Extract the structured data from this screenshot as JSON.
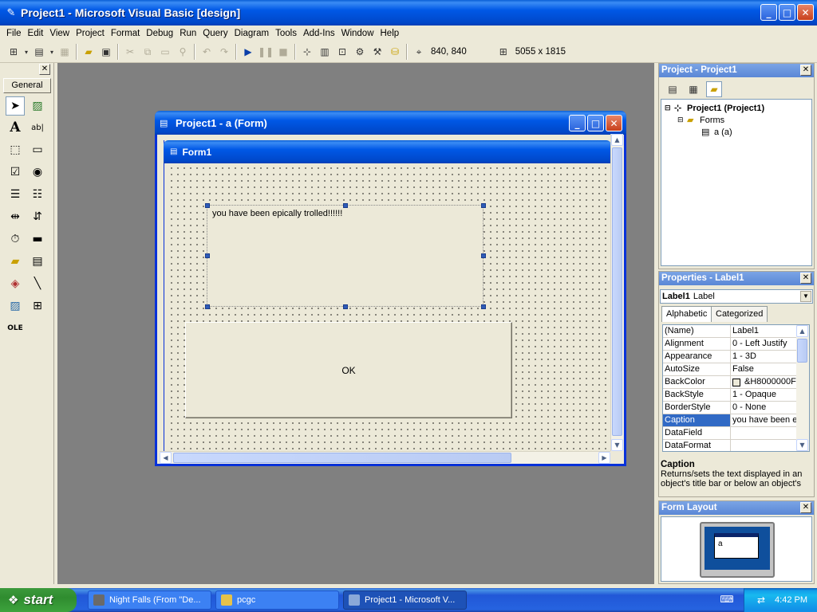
{
  "title_bar": {
    "title": "Project1 - Microsoft Visual Basic [design]"
  },
  "menu": [
    "File",
    "Edit",
    "View",
    "Project",
    "Format",
    "Debug",
    "Run",
    "Query",
    "Diagram",
    "Tools",
    "Add-Ins",
    "Window",
    "Help"
  ],
  "toolbar": {
    "position": "840, 840",
    "size": "5055 x 1815"
  },
  "toolbox": {
    "tab_label": "General"
  },
  "designer": {
    "window_title": "Project1 - a (Form)",
    "form_caption": "Form1",
    "label_caption": "you have been epically trolled!!!!!!",
    "button_caption": "OK"
  },
  "project_explorer": {
    "title": "Project - Project1",
    "root": "Project1 (Project1)",
    "folder": "Forms",
    "item": "a (a)"
  },
  "properties": {
    "title": "Properties - Label1",
    "object_name": "Label1",
    "object_type": "Label",
    "tabs": [
      "Alphabetic",
      "Categorized"
    ],
    "rows": [
      {
        "name": "(Name)",
        "value": "Label1"
      },
      {
        "name": "Alignment",
        "value": "0 - Left Justify"
      },
      {
        "name": "Appearance",
        "value": "1 - 3D"
      },
      {
        "name": "AutoSize",
        "value": "False"
      },
      {
        "name": "BackColor",
        "value": "&H8000000F"
      },
      {
        "name": "BackStyle",
        "value": "1 - Opaque"
      },
      {
        "name": "BorderStyle",
        "value": "0 - None"
      },
      {
        "name": "Caption",
        "value": "you have been epically trolled!!!!!!"
      },
      {
        "name": "DataField",
        "value": ""
      },
      {
        "name": "DataFormat",
        "value": ""
      }
    ],
    "selected_row": 7,
    "desc_title": "Caption",
    "desc_text": "Returns/sets the text displayed in an object's title bar or below an object's"
  },
  "form_layout": {
    "title": "Form Layout",
    "preview_label": "a"
  },
  "taskbar": {
    "start_label": "start",
    "tasks": [
      "Night Falls (From \"De...",
      "pcgc",
      "Project1 - Microsoft V..."
    ],
    "clock": "4:42 PM"
  },
  "colors": {
    "accent": "#0054e3",
    "selection": "#316ac5",
    "mdi_background": "#808080"
  }
}
